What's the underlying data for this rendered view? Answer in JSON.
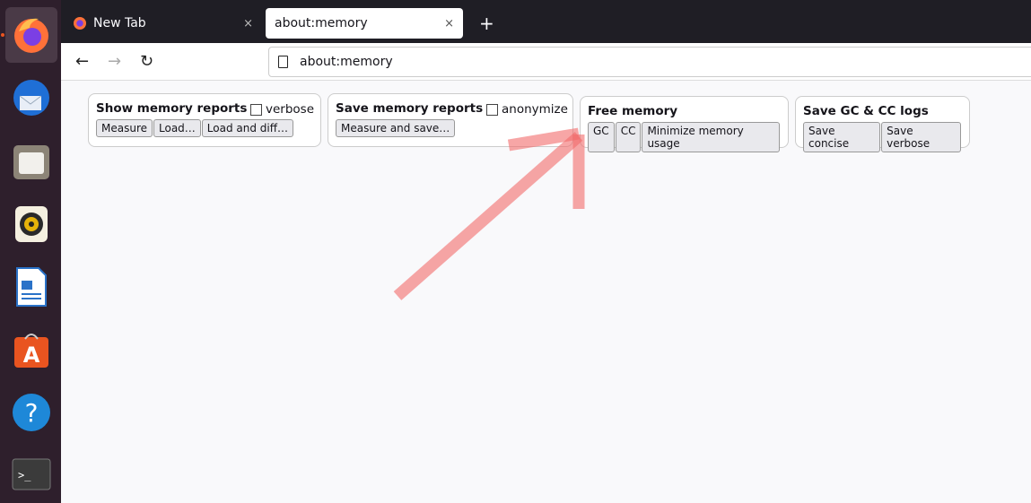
{
  "dock": {
    "items": [
      "firefox",
      "thunderbird",
      "files",
      "rhythmbox",
      "libreoffice-writer",
      "ubuntu-software",
      "help",
      "terminal"
    ]
  },
  "tabs": [
    {
      "label": "New Tab",
      "close": "×"
    },
    {
      "label": "about:memory",
      "close": "×"
    }
  ],
  "new_tab": "+",
  "nav": {
    "back": "←",
    "forward": "→",
    "reload": "↻",
    "url": "about:memory"
  },
  "sections": {
    "show": {
      "title": "Show memory reports",
      "checkbox": "verbose",
      "buttons": [
        "Measure",
        "Load…",
        "Load and diff…"
      ]
    },
    "save": {
      "title": "Save memory reports",
      "checkbox": "anonymize",
      "buttons": [
        "Measure and save…"
      ]
    },
    "free": {
      "title": "Free memory",
      "buttons": [
        "GC",
        "CC",
        "Minimize memory usage"
      ]
    },
    "gccc": {
      "title": "Save GC & CC logs",
      "buttons": [
        "Save concise",
        "Save verbose"
      ]
    }
  },
  "annotation": {
    "color": "#f26a6a"
  }
}
